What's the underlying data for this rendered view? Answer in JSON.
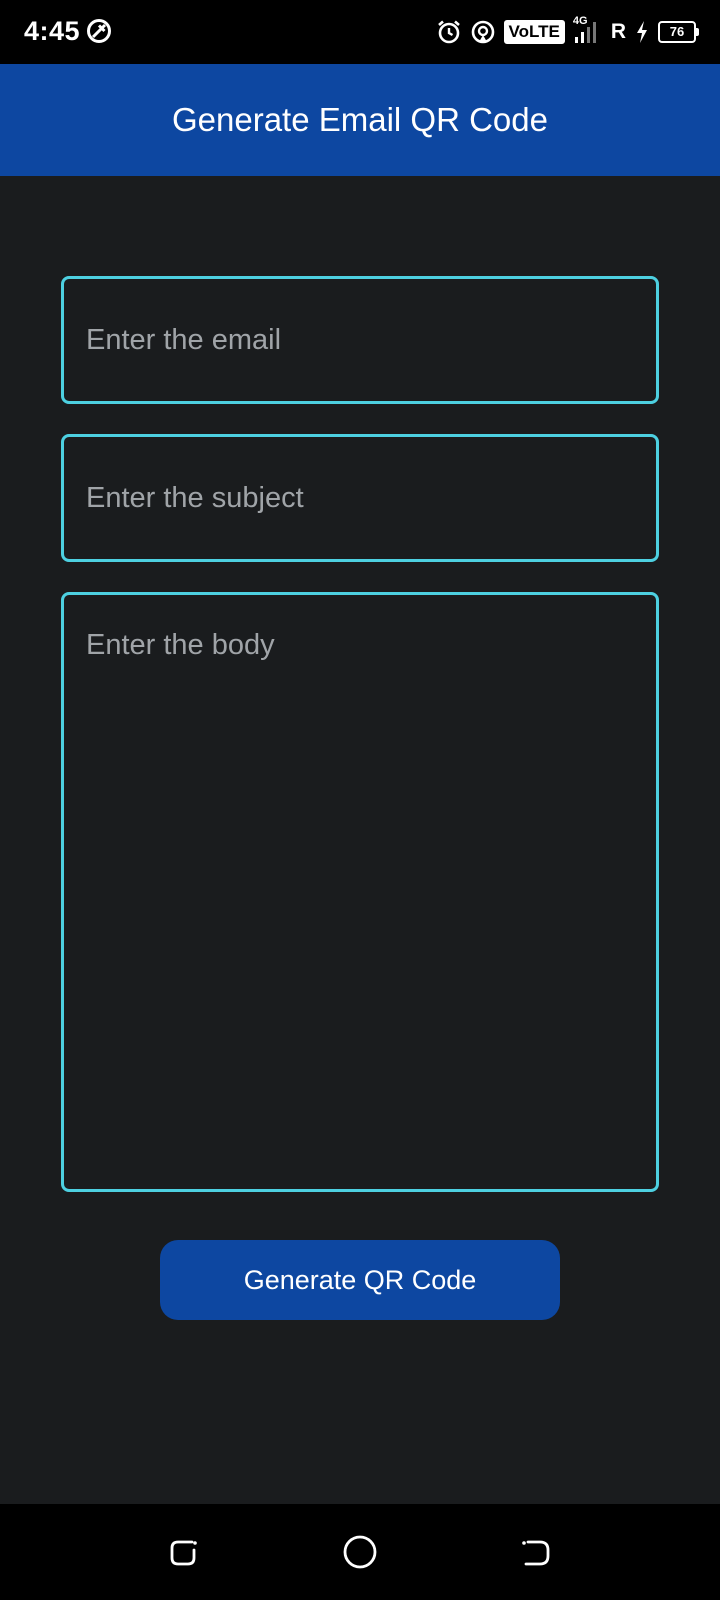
{
  "status_bar": {
    "time": "4:45",
    "volte": "VoLTE",
    "network": "4G",
    "roaming": "R",
    "battery": "76"
  },
  "app_bar": {
    "title": "Generate Email QR Code"
  },
  "form": {
    "email_placeholder": "Enter the email",
    "subject_placeholder": "Enter the subject",
    "body_placeholder": "Enter the body",
    "generate_label": "Generate QR Code"
  },
  "colors": {
    "app_bar": "#0d47a1",
    "background": "#1a1c1e",
    "field_border": "#4dd0e1",
    "button": "#0d47a1"
  },
  "icons": {
    "status_left": "data-saver-icon",
    "alarm": "alarm-icon",
    "hotspot": "hotspot-icon",
    "signal": "signal-icon",
    "charging": "charging-icon",
    "nav_recents": "recents-icon",
    "nav_home": "home-icon",
    "nav_back": "back-icon"
  }
}
